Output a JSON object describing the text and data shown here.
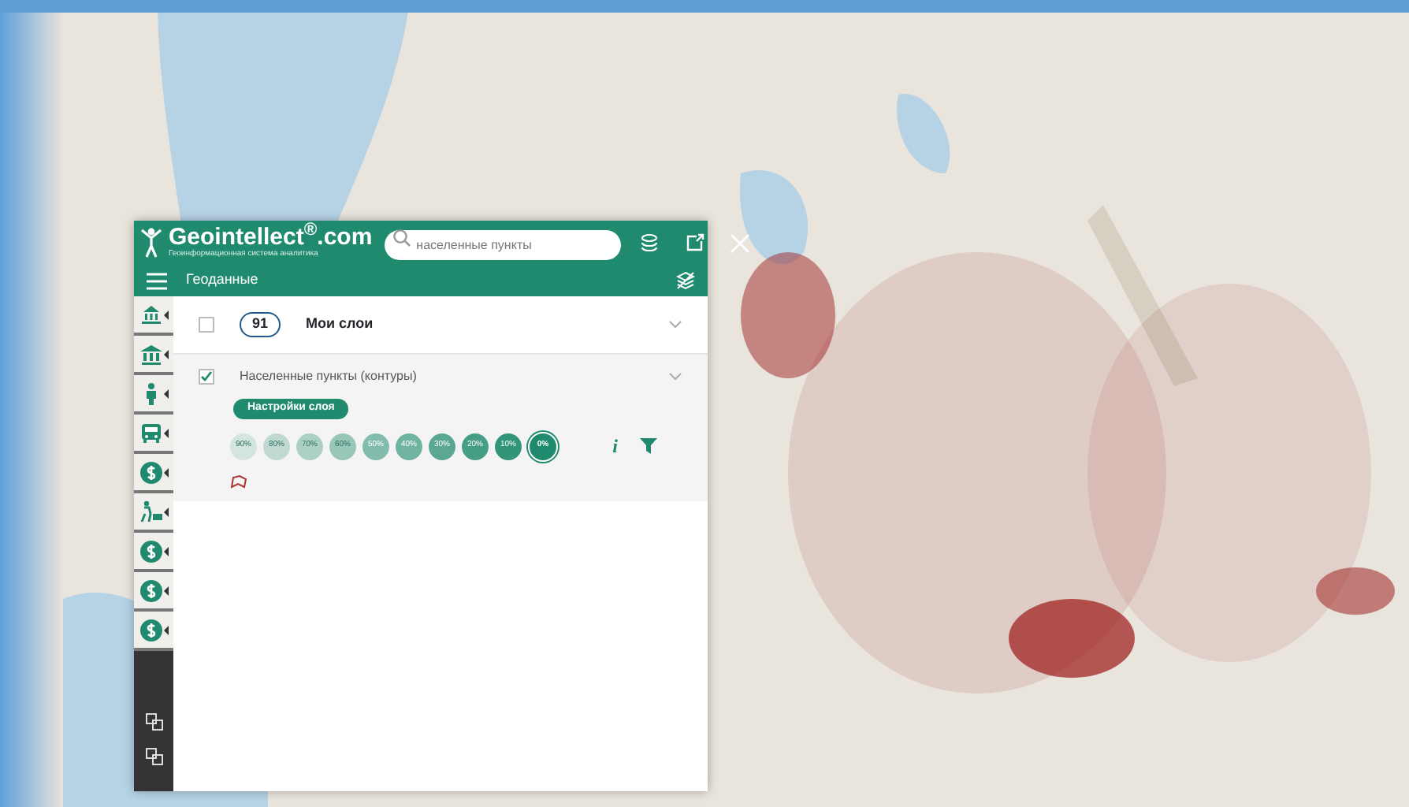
{
  "logo": {
    "text": "Geointellect$^{®}$.com",
    "tagline": "Геоинформационная система аналитика"
  },
  "search": {
    "placeholder": "населенные пункты"
  },
  "header": {
    "title": "Геоданные"
  },
  "side_tools": [
    {
      "kind": "museum"
    },
    {
      "kind": "bank"
    },
    {
      "kind": "person"
    },
    {
      "kind": "bus"
    },
    {
      "kind": "dollar"
    },
    {
      "kind": "cart"
    },
    {
      "kind": "dollar"
    },
    {
      "kind": "dollar"
    },
    {
      "kind": "dollar"
    }
  ],
  "groups": [
    {
      "count": "91",
      "name": "Мои слои",
      "checked": false
    }
  ],
  "layers": [
    {
      "name": "Населенные пункты (контуры)",
      "checked": true,
      "settings_label": "Настройки слоя",
      "info_label": "i",
      "opacity": [
        {
          "label": "90%",
          "selected": false
        },
        {
          "label": "80%",
          "selected": false
        },
        {
          "label": "70%",
          "selected": false
        },
        {
          "label": "60%",
          "selected": false
        },
        {
          "label": "50%",
          "selected": false
        },
        {
          "label": "40%",
          "selected": false
        },
        {
          "label": "30%",
          "selected": false
        },
        {
          "label": "20%",
          "selected": false
        },
        {
          "label": "10%",
          "selected": false
        },
        {
          "label": "0%",
          "selected": true
        }
      ]
    }
  ]
}
